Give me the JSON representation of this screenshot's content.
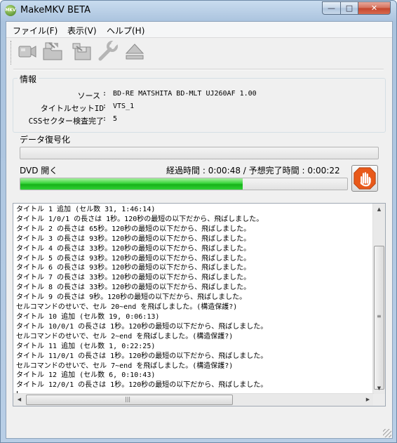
{
  "window": {
    "title": "MakeMKV BETA",
    "icon_text": "MKV"
  },
  "menu": {
    "items": [
      "ファイル(F)",
      "表示(V)",
      "ヘルプ(H)"
    ]
  },
  "toolbar": {
    "buttons": [
      "open-disc-icon",
      "open-files-icon",
      "backup-icon",
      "settings-wrench-icon",
      "eject-icon"
    ]
  },
  "info": {
    "legend": "情報",
    "rows": [
      {
        "label": "ソース",
        "value": "BD-RE MATSHITA BD-MLT UJ260AF 1.00"
      },
      {
        "label": "タイトルセットID",
        "value": "VTS_1"
      },
      {
        "label": "CSSセクター検査完了",
        "value": "5"
      }
    ]
  },
  "progress": {
    "data_decrypt_label": "データ復号化",
    "data_decrypt_fraction": 0.0,
    "current_label": "DVD 開く",
    "elapsed_label": "経過時間",
    "elapsed_value": "0:00:48",
    "remaining_label": "予想完了時間",
    "remaining_value": "0:00:22",
    "current_fraction": 0.68
  },
  "log": {
    "lines": [
      "タイトル 1 追加 (セル数 31, 1:46:14)",
      "タイトル 1/0/1 の長さは 1秒。120秒の最短の以下だから、飛ばしました。",
      "タイトル 2 の長さは 65秒。120秒の最短の以下だから、飛ばしました。",
      "タイトル 3 の長さは 93秒。120秒の最短の以下だから、飛ばしました。",
      "タイトル 4 の長さは 33秒。120秒の最短の以下だから、飛ばしました。",
      "タイトル 5 の長さは 93秒。120秒の最短の以下だから、飛ばしました。",
      "タイトル 6 の長さは 93秒。120秒の最短の以下だから、飛ばしました。",
      "タイトル 7 の長さは 33秒。120秒の最短の以下だから、飛ばしました。",
      "タイトル 8 の長さは 33秒。120秒の最短の以下だから、飛ばしました。",
      "タイトル 9 の長さは 9秒。120秒の最短の以下だから、飛ばしました。",
      "セルコマンドのせいで、セル 20~end を飛ばしました。(構造保護?)",
      "タイトル 10 追加 (セル数 19, 0:06:13)",
      "タイトル 10/0/1 の長さは 1秒。120秒の最短の以下だから、飛ばしました。",
      "セルコマンドのせいで、セル 2~end を飛ばしました。(構造保護?)",
      "タイトル 11 追加 (セル数 1, 0:22:25)",
      "タイトル 11/0/1 の長さは 1秒。120秒の最短の以下だから、飛ばしました。",
      "セルコマンドのせいで、セル 7~end を飛ばしました。(構造保護?)",
      "タイトル 12 追加 (セル数 6, 0:10:43)",
      "タイトル 12/0/1 の長さは 1秒。120秒の最短の以下だから、飛ばしました。"
    ]
  },
  "colors": {
    "progress_green": "#17b21a",
    "stop_orange": "#e8591a",
    "close_red": "#c4452c"
  }
}
